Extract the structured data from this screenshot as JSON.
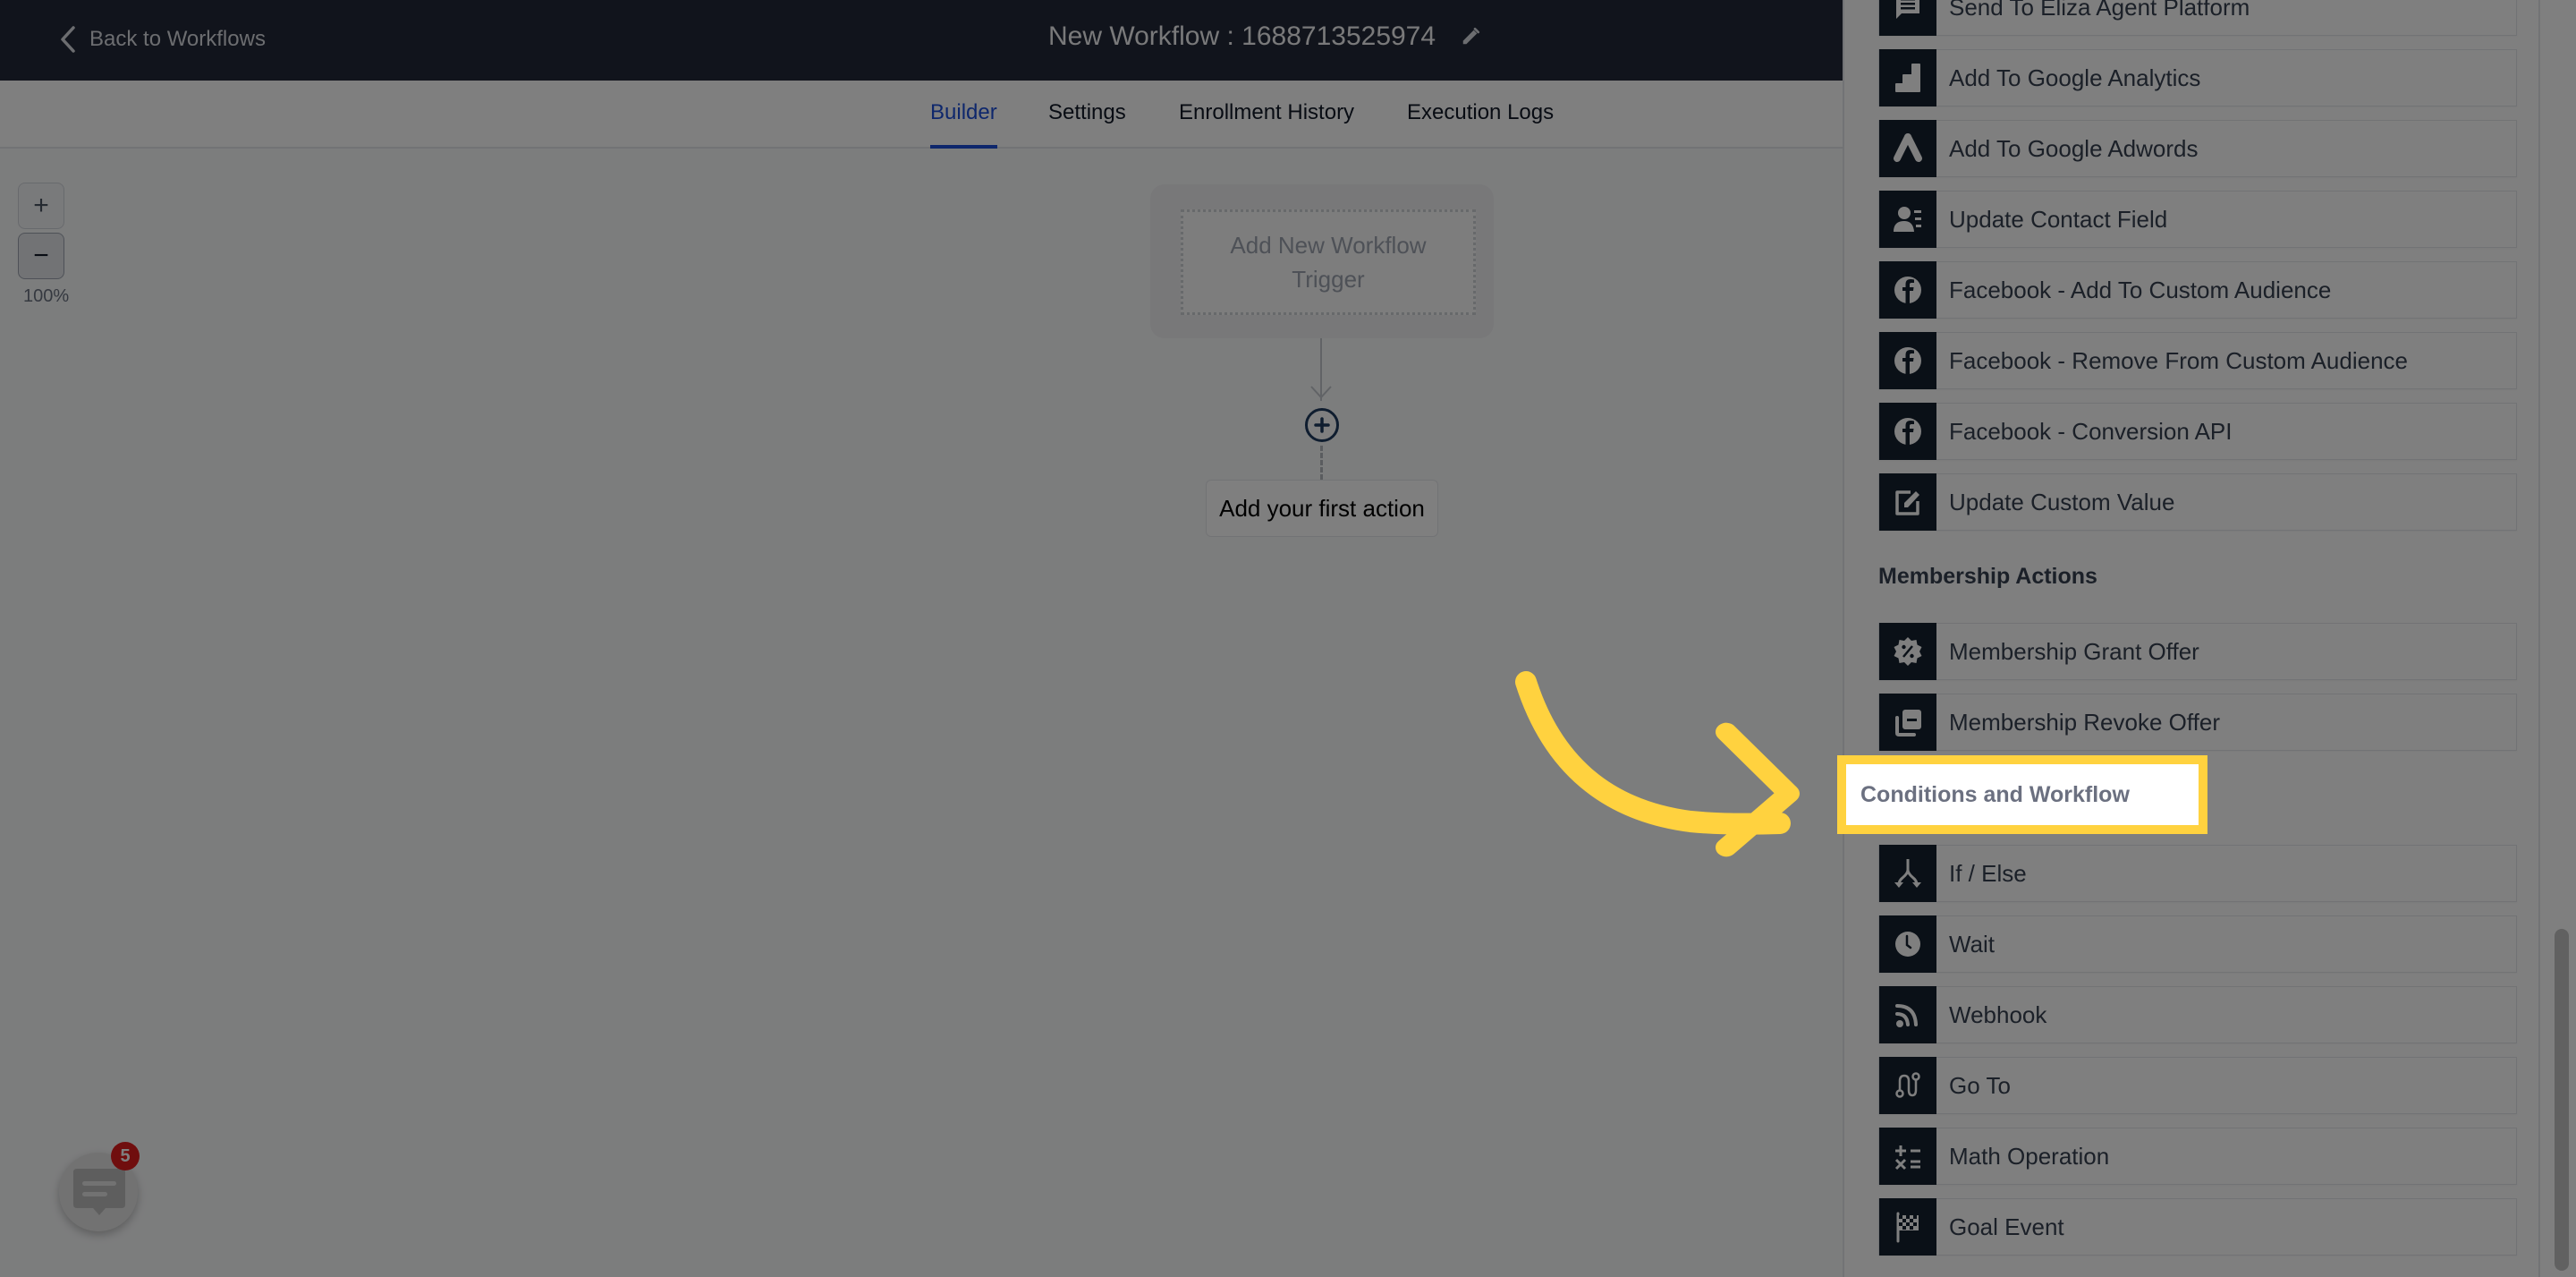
{
  "header": {
    "back_label": "Back to Workflows",
    "title": "New Workflow : 1688713525974",
    "edit_icon": "pencil-icon",
    "bg_color": "#222938"
  },
  "tabs": [
    {
      "label": "Builder",
      "active": true
    },
    {
      "label": "Settings",
      "active": false
    },
    {
      "label": "Enrollment History",
      "active": false
    },
    {
      "label": "Execution Logs",
      "active": false
    }
  ],
  "canvas": {
    "zoom_in_label": "+",
    "zoom_out_label": "−",
    "zoom_level": "100%",
    "trigger_label": "Add New Workflow Trigger",
    "first_action_label": "Add your first action"
  },
  "chat": {
    "badge_count": "5"
  },
  "panel": {
    "top_items": [
      {
        "label": "Send To Eliza Agent Platform",
        "icon": "chat-message-icon"
      },
      {
        "label": "Add To Google Analytics",
        "icon": "google-analytics-icon"
      },
      {
        "label": "Add To Google Adwords",
        "icon": "google-ads-icon"
      },
      {
        "label": "Update Contact Field",
        "icon": "contact-field-icon"
      },
      {
        "label": "Facebook - Add To Custom Audience",
        "icon": "facebook-icon"
      },
      {
        "label": "Facebook - Remove From Custom Audience",
        "icon": "facebook-icon"
      },
      {
        "label": "Facebook - Conversion API",
        "icon": "facebook-icon"
      },
      {
        "label": "Update Custom Value",
        "icon": "edit-square-icon"
      }
    ],
    "membership_title": "Membership Actions",
    "membership_items": [
      {
        "label": "Membership Grant Offer",
        "icon": "discount-badge-icon"
      },
      {
        "label": "Membership Revoke Offer",
        "icon": "stack-minus-icon"
      }
    ],
    "conditions_title": "Conditions and Workflow",
    "conditions_items": [
      {
        "label": "If / Else",
        "icon": "branch-split-icon"
      },
      {
        "label": "Wait",
        "icon": "clock-icon"
      },
      {
        "label": "Webhook",
        "icon": "rss-icon"
      },
      {
        "label": "Go To",
        "icon": "route-icon"
      },
      {
        "label": "Math Operation",
        "icon": "calculator-icon"
      },
      {
        "label": "Goal Event",
        "icon": "checkered-flag-icon"
      }
    ]
  },
  "annotation": {
    "highlight_color": "#ffd23f",
    "highlight_text": "Conditions and Workflow"
  }
}
